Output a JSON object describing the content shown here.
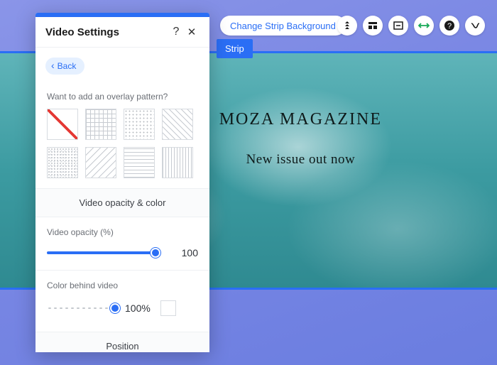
{
  "toolbar": {
    "changeStrip": "Change Strip Background"
  },
  "chip": {
    "strip": "Strip"
  },
  "hero": {
    "title": "MOZA MAGAZINE",
    "subtitle": "New issue out now"
  },
  "panel": {
    "title": "Video Settings",
    "help": "?",
    "close": "✕",
    "back": "Back",
    "overlayQuestion": "Want to add an overlay pattern?",
    "patterns": [
      "none",
      "grid",
      "dots",
      "diag",
      "noise",
      "diag2",
      "hlines",
      "vlines"
    ],
    "sections": {
      "opacityColor": "Video opacity & color",
      "position": "Position"
    },
    "fields": {
      "videoOpacity": {
        "label": "Video opacity (%)",
        "value": "100",
        "percent": 100
      },
      "colorBehind": {
        "label": "Color behind video",
        "value": "100%",
        "percent": 100,
        "swatch": "#ffffff"
      }
    }
  }
}
